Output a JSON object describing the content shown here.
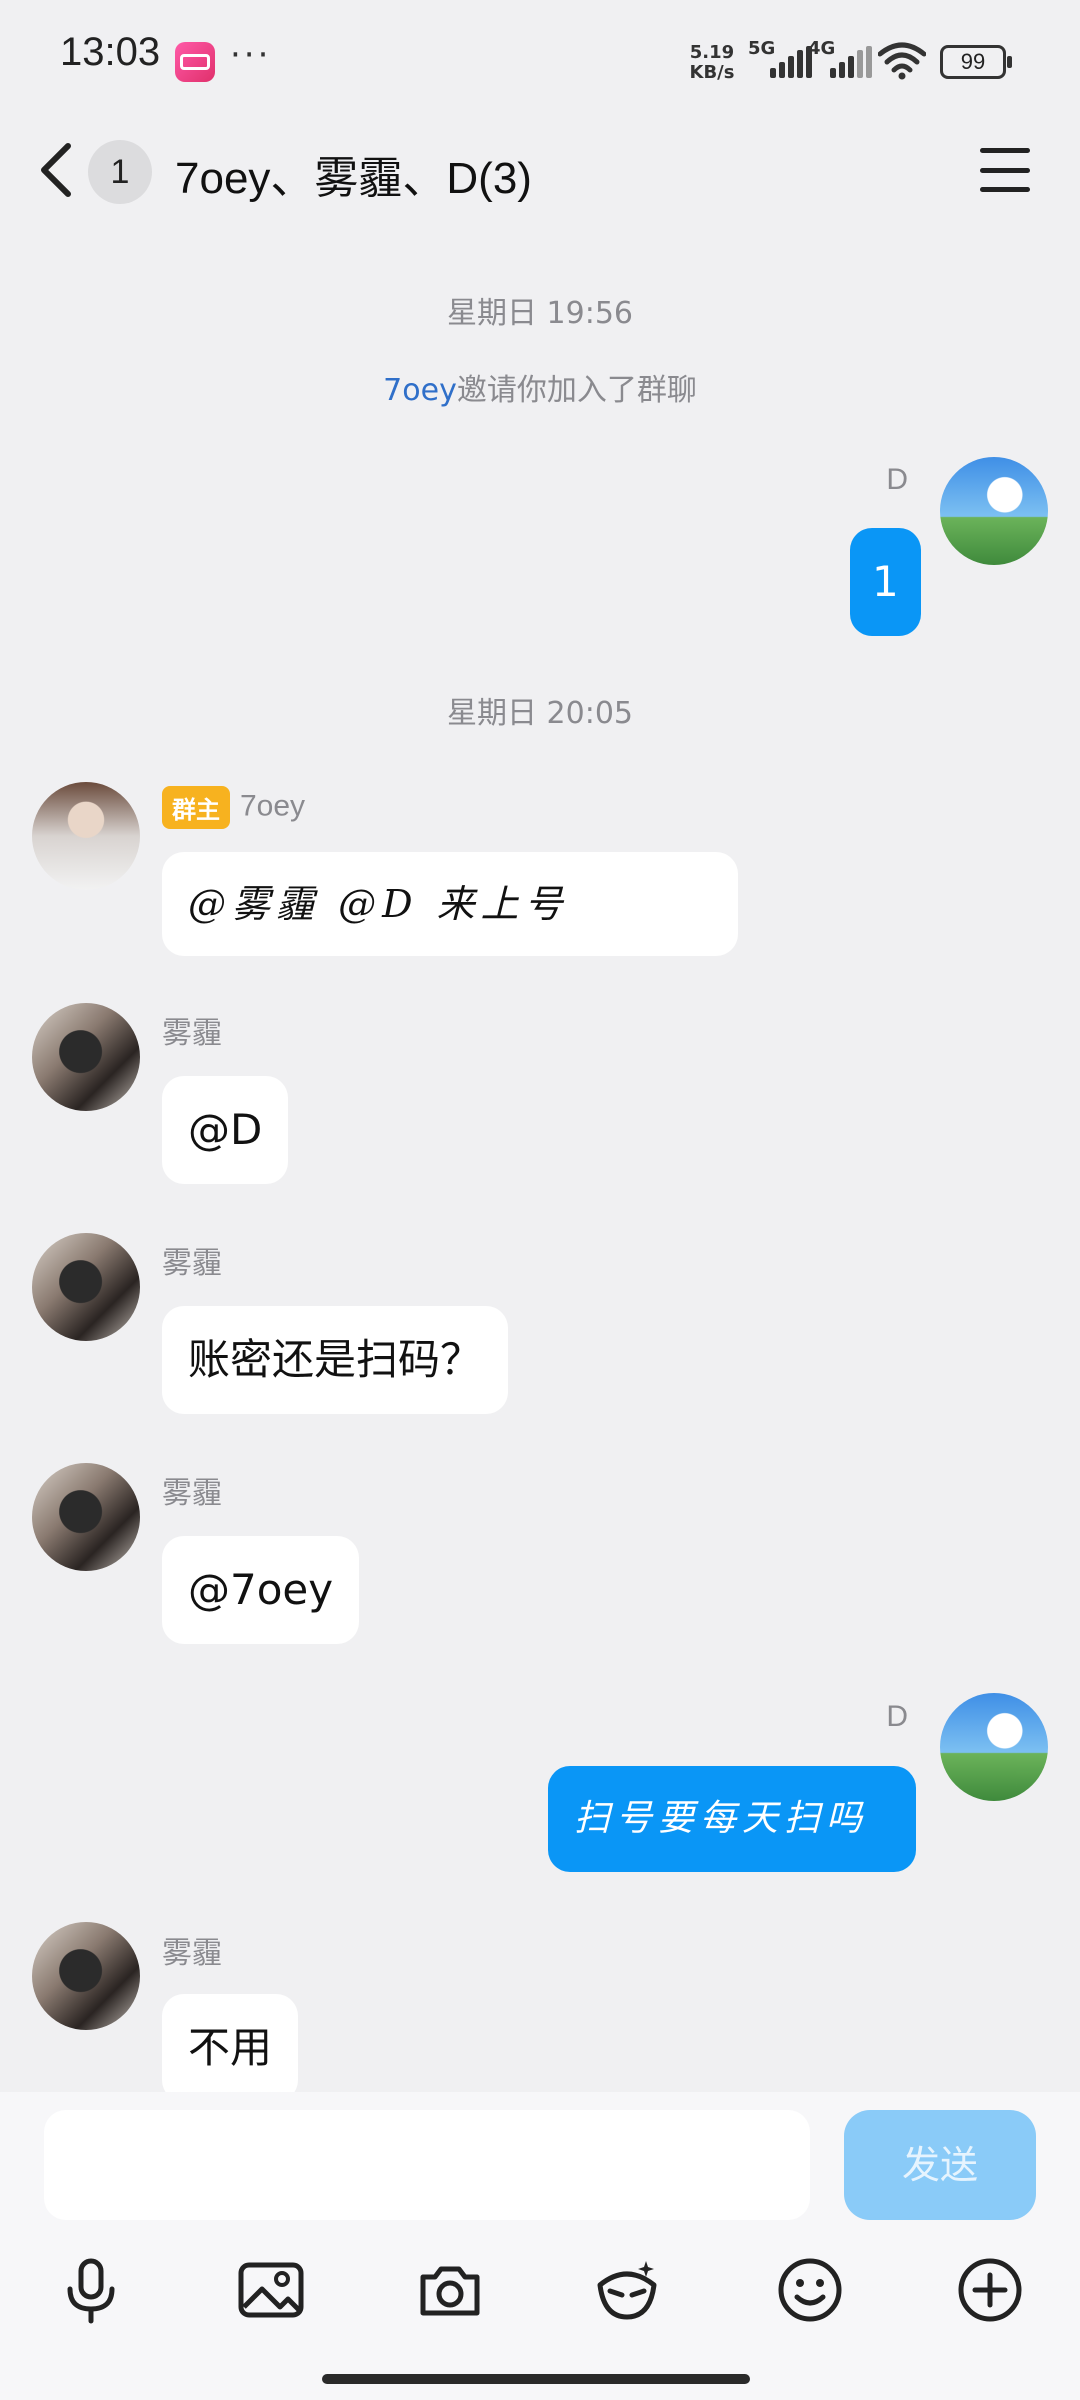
{
  "status_bar": {
    "time": "13:03",
    "more": "···",
    "net_speed_value": "5.19",
    "net_speed_unit": "KB/s",
    "signal1_label": "5G",
    "signal2_label": "4G",
    "battery": "99"
  },
  "header": {
    "unread_count": "1",
    "title": "7oey、雾霾、D(3)"
  },
  "messages": {
    "time1": "星期日 19:56",
    "system": {
      "inviter": "7oey",
      "text": "邀请你加入了群聊"
    },
    "m1": {
      "sender": "D",
      "text": "1"
    },
    "time2": "星期日 20:05",
    "m2": {
      "badge": "群主",
      "sender": "7oey",
      "text": "@雾霾 @D 来上号"
    },
    "m3": {
      "sender": "雾霾",
      "text": "@D"
    },
    "m4": {
      "sender": "雾霾",
      "text": "账密还是扫码？"
    },
    "m5": {
      "sender": "雾霾",
      "text": "@7oey"
    },
    "m6": {
      "sender": "D",
      "text": "扫号要每天扫吗"
    },
    "m7": {
      "sender": "雾霾",
      "text": "不用"
    }
  },
  "input": {
    "placeholder": "",
    "send_label": "发送"
  },
  "colors": {
    "accent": "#0a96f6",
    "send_disabled": "#8acbf8",
    "owner_badge": "#f7b21f",
    "background": "#f0f0f2"
  },
  "toolbar_icons": [
    "microphone-icon",
    "image-icon",
    "camera-icon",
    "red-packet-mask-icon",
    "emoji-icon",
    "plus-circle-icon"
  ]
}
